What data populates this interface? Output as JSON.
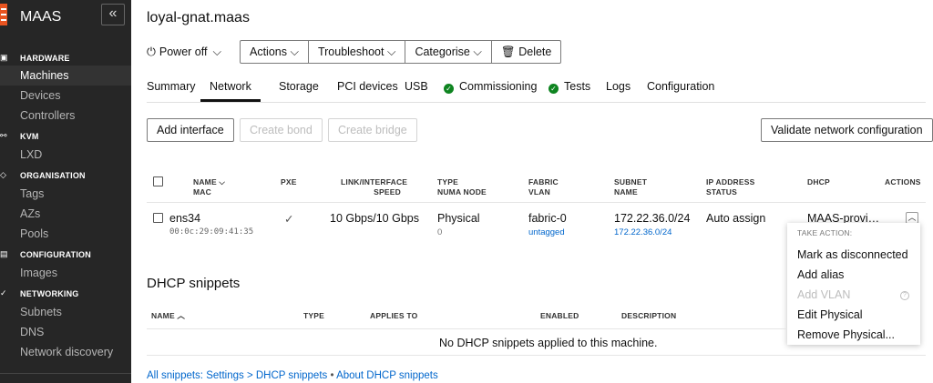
{
  "sidebar": {
    "title": "MAAS",
    "collapse_icon": "«",
    "sections": [
      {
        "label": "HARDWARE",
        "icon": "hardware-icon",
        "items": [
          "Machines",
          "Devices",
          "Controllers"
        ]
      },
      {
        "label": "KVM",
        "icon": "kvm-icon",
        "items": [
          "LXD"
        ]
      },
      {
        "label": "ORGANISATION",
        "icon": "organisation-icon",
        "items": [
          "Tags",
          "AZs",
          "Pools"
        ]
      },
      {
        "label": "CONFIGURATION",
        "icon": "configuration-icon",
        "items": [
          "Images"
        ]
      },
      {
        "label": "NETWORKING",
        "icon": "networking-icon",
        "items": [
          "Subnets",
          "DNS",
          "Network discovery"
        ]
      }
    ],
    "active_item": "Machines"
  },
  "header": {
    "title": "loyal-gnat.maas",
    "power_label": "Power off",
    "actions": [
      "Actions",
      "Troubleshoot",
      "Categorise",
      "Delete"
    ]
  },
  "tabs": [
    "Summary",
    "Network",
    "Storage",
    "PCI devices",
    "USB",
    "Commissioning",
    "Tests",
    "Logs",
    "Configuration"
  ],
  "active_tab": "Network",
  "toolbar": {
    "add_interface": "Add interface",
    "create_bond": "Create bond",
    "create_bridge": "Create bridge",
    "validate": "Validate network configuration"
  },
  "table": {
    "headers": {
      "name": "NAME",
      "mac": "MAC",
      "pxe": "PXE",
      "link": "LINK/INTERFACE",
      "speed": "SPEED",
      "type": "TYPE",
      "numa": "NUMA NODE",
      "fabric": "FABRIC",
      "vlan": "VLAN",
      "subnet": "SUBNET",
      "subnet_name": "NAME",
      "ip": "IP ADDRESS",
      "status": "STATUS",
      "dhcp": "DHCP",
      "actions": "ACTIONS"
    },
    "row": {
      "name": "ens34",
      "mac": "00:0c:29:09:41:35",
      "pxe": "✓",
      "speed": "10 Gbps/10 Gbps",
      "type": "Physical",
      "numa": "0",
      "fabric": "fabric-0",
      "vlan": "untagged",
      "subnet": "172.22.36.0/24",
      "subnet_name": "172.22.36.0/24",
      "ip_mode": "Auto assign",
      "dhcp": "MAAS-provi…"
    }
  },
  "dropdown": {
    "header": "TAKE ACTION:",
    "items": [
      "Mark as disconnected",
      "Add alias",
      "Add VLAN",
      "Edit Physical",
      "Remove Physical..."
    ],
    "disabled": [
      "Add VLAN"
    ]
  },
  "dhcp": {
    "title": "DHCP snippets",
    "headers": [
      "NAME",
      "TYPE",
      "APPLIES TO",
      "ENABLED",
      "DESCRIPTION"
    ],
    "empty": "No DHCP snippets applied to this machine."
  },
  "footer": {
    "settings_link": "All snippets: Settings > DHCP snippets",
    "separator": "•",
    "about_link": "About DHCP snippets"
  }
}
